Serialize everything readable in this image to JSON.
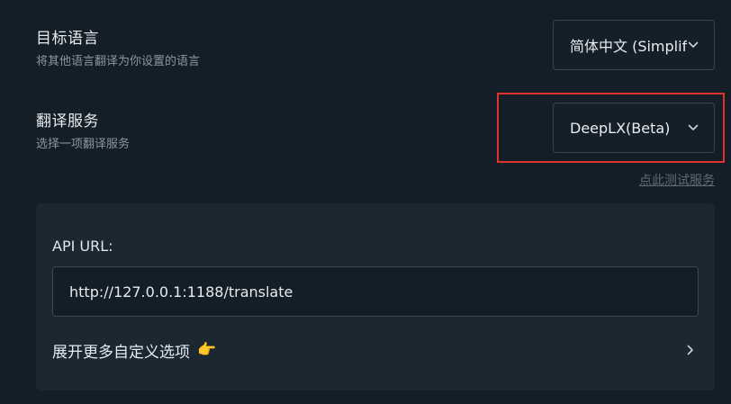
{
  "target_language": {
    "title": "目标语言",
    "description": "将其他语言翻译为你设置的语言",
    "selected": "简体中文 (Simplified Chinese)"
  },
  "translation_service": {
    "title": "翻译服务",
    "description": "选择一项翻译服务",
    "selected": "DeepLX(Beta)",
    "test_link": "点此测试服务"
  },
  "deeplx_panel": {
    "api_url_label": "API URL:",
    "api_url_value": "http://127.0.0.1:1188/translate",
    "expand_label": "展开更多自定义选项",
    "expand_emoji": "👉"
  },
  "colors": {
    "background": "#141e26",
    "panel": "#1b2731",
    "highlight": "#e0322a",
    "muted_text": "#8a96a3"
  },
  "icons": {
    "select_arrow": "chevron-down-icon",
    "expand_arrow": "chevron-right-icon"
  }
}
